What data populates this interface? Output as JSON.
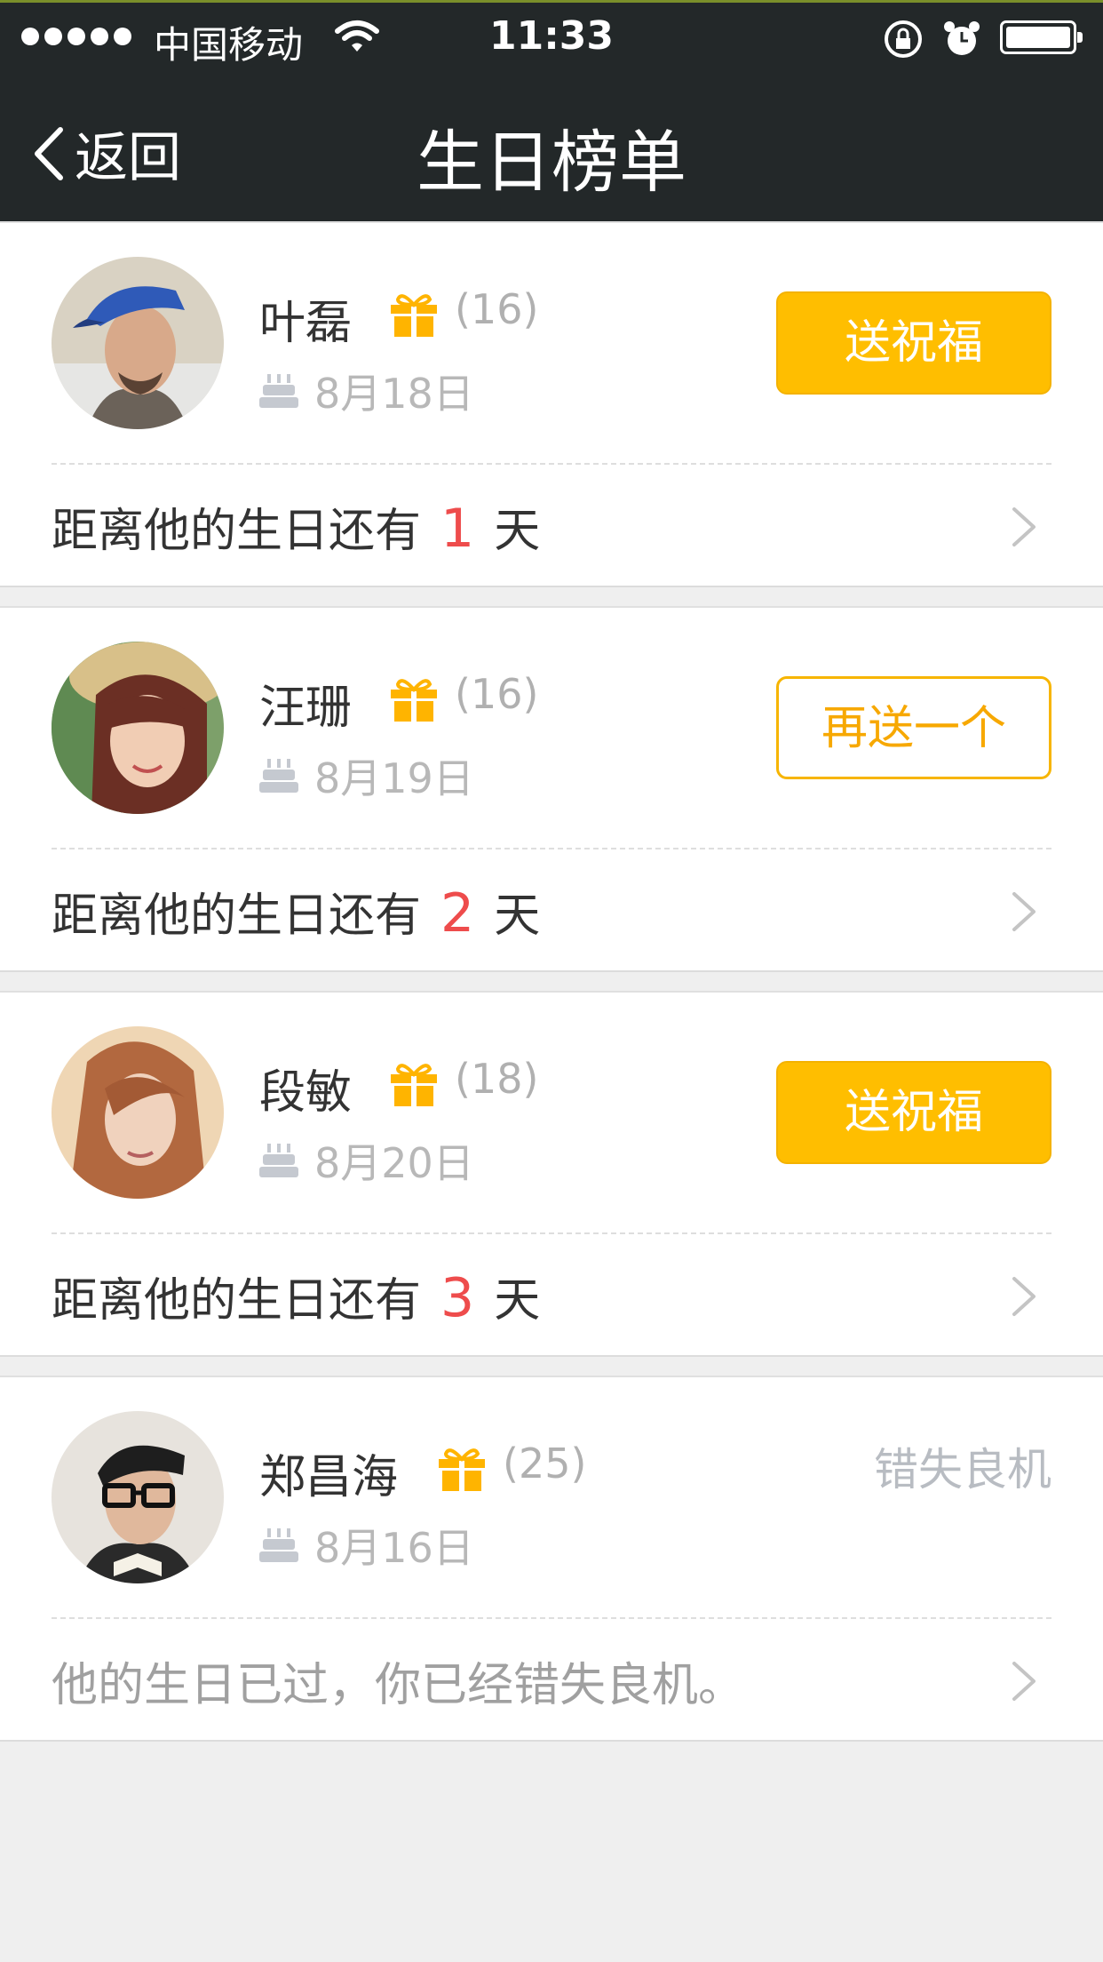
{
  "status_bar": {
    "carrier": "中国移动",
    "time": "11:33"
  },
  "nav": {
    "back_label": "返回",
    "title": "生日榜单"
  },
  "entries": [
    {
      "name": "叶磊",
      "age": "(16)",
      "date": "8月18日",
      "action": "送祝福",
      "prefix": "距离他的生日还有",
      "days": "1",
      "suffix": "天"
    },
    {
      "name": "汪珊",
      "age": "(16)",
      "date": "8月19日",
      "action": "再送一个",
      "prefix": "距离他的生日还有",
      "days": "2",
      "suffix": "天"
    },
    {
      "name": "段敏",
      "age": "(18)",
      "date": "8月20日",
      "action": "送祝福",
      "prefix": "距离他的生日还有",
      "days": "3",
      "suffix": "天"
    },
    {
      "name": "郑昌海",
      "age": "(25)",
      "date": "8月16日",
      "status": "错失良机",
      "message": "他的生日已过，你已经错失良机。"
    }
  ],
  "colors": {
    "accent": "#ffbe00",
    "highlight": "#ee4c4c",
    "header": "#232829"
  }
}
